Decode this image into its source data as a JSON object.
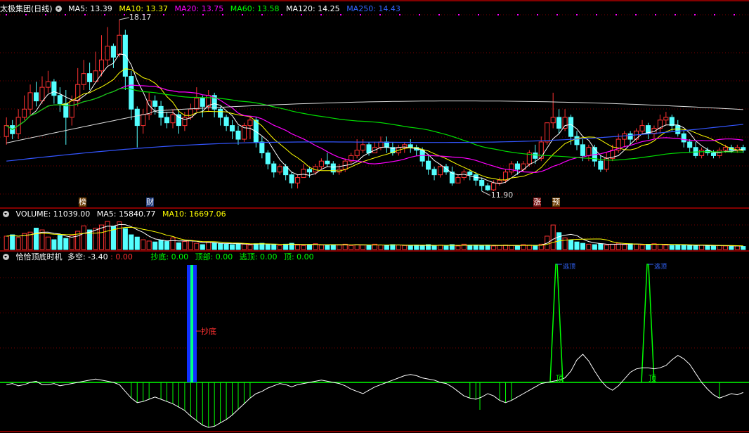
{
  "panel1": {
    "title": "太极集团(日线)",
    "indicators": [
      {
        "label": "MA5: 13.39",
        "color": "#ffffff"
      },
      {
        "label": "MA10: 13.37",
        "color": "#ffff00"
      },
      {
        "label": "MA20: 13.75",
        "color": "#ff00ff"
      },
      {
        "label": "MA60: 13.58",
        "color": "#00ff00"
      },
      {
        "label": "MA120: 14.25",
        "color": "#ffffff"
      },
      {
        "label": "MA250: 14.43",
        "color": "#3366ff"
      }
    ],
    "high_label": "18.17",
    "low_label": "11.90",
    "markers": [
      {
        "text": "榜",
        "color": "#ffb060"
      },
      {
        "text": "财",
        "color": "#88aaff"
      },
      {
        "text": "涨",
        "color": "#ff6060"
      },
      {
        "text": "预",
        "color": "#ffb060"
      }
    ]
  },
  "panel2": {
    "indicators": [
      {
        "label": "VOLUME: 11039.00",
        "color": "#ffffff"
      },
      {
        "label": "MA5: 15840.77",
        "color": "#ffffff"
      },
      {
        "label": "MA10: 16697.06",
        "color": "#ffff00"
      }
    ]
  },
  "panel3": {
    "indicators": [
      {
        "label": "恰恰顶底时机",
        "color": "#ffffff"
      },
      {
        "label": "多空: -3.40",
        "color": "#ffffff"
      },
      {
        "label": ": 0.00",
        "color": "#ff3030"
      },
      {
        "label": "抄底: 0.00",
        "color": "#00ff00"
      },
      {
        "label": "顶部: 0.00",
        "color": "#00ff00"
      },
      {
        "label": "逃顶: 0.00",
        "color": "#00ff00"
      },
      {
        "label": "顶: 0.00",
        "color": "#00ff00"
      }
    ],
    "buy_label": "抄底",
    "top_label": "顶",
    "escape_label": "逃顶"
  },
  "colors": {
    "up": "#ff3232",
    "down": "#54ffff",
    "grid": "#7a0000",
    "border": "#b00000"
  },
  "chart_data": [
    {
      "type": "candlestick",
      "title": "太极集团(日线)",
      "y_high": 18.17,
      "y_low": 11.9,
      "candles": [
        [
          13.9,
          14.3,
          14.6,
          13.6
        ],
        [
          14.3,
          14.0,
          14.5,
          13.8
        ],
        [
          14.0,
          14.6,
          14.9,
          13.8
        ],
        [
          14.6,
          14.9,
          15.4,
          14.5
        ],
        [
          14.9,
          15.5,
          15.8,
          14.7
        ],
        [
          15.5,
          15.2,
          15.9,
          15.0
        ],
        [
          15.2,
          15.7,
          16.1,
          15.1
        ],
        [
          15.7,
          15.9,
          16.3,
          15.5
        ],
        [
          15.9,
          15.4,
          16.0,
          15.1
        ],
        [
          15.4,
          15.1,
          15.7,
          14.8
        ],
        [
          15.1,
          14.6,
          15.6,
          13.6
        ],
        [
          14.6,
          15.2,
          15.4,
          14.3
        ],
        [
          15.2,
          15.8,
          16.4,
          15.0
        ],
        [
          15.8,
          16.2,
          16.7,
          15.6
        ],
        [
          16.2,
          15.9,
          16.6,
          15.6
        ],
        [
          15.9,
          16.3,
          17.0,
          15.9
        ],
        [
          16.3,
          16.7,
          17.6,
          16.1
        ],
        [
          16.7,
          17.2,
          17.9,
          16.5
        ],
        [
          17.2,
          16.8,
          17.3,
          16.4
        ],
        [
          16.9,
          17.6,
          18.17,
          16.8
        ],
        [
          17.6,
          16.1,
          17.8,
          15.6
        ],
        [
          16.1,
          14.9,
          16.3,
          14.5
        ],
        [
          14.9,
          14.3,
          15.0,
          13.5
        ],
        [
          14.3,
          14.7,
          14.9,
          14.0
        ],
        [
          14.7,
          15.2,
          15.5,
          14.5
        ],
        [
          15.2,
          15.0,
          15.4,
          14.7
        ],
        [
          15.0,
          14.6,
          15.2,
          14.3
        ],
        [
          14.6,
          14.4,
          14.8,
          14.2
        ],
        [
          14.4,
          14.7,
          14.9,
          14.2
        ],
        [
          14.7,
          14.3,
          14.9,
          14.0
        ],
        [
          14.3,
          14.6,
          14.8,
          14.1
        ],
        [
          14.6,
          14.9,
          15.1,
          14.5
        ],
        [
          14.9,
          15.3,
          15.7,
          14.8
        ],
        [
          15.3,
          15.0,
          15.4,
          14.6
        ],
        [
          15.0,
          15.4,
          15.6,
          14.8
        ],
        [
          15.4,
          14.9,
          15.5,
          14.6
        ],
        [
          14.9,
          14.6,
          15.0,
          14.3
        ],
        [
          14.6,
          14.3,
          14.7,
          14.1
        ],
        [
          14.3,
          14.1,
          14.5,
          13.8
        ],
        [
          14.1,
          13.8,
          14.3,
          13.6
        ],
        [
          13.8,
          14.3,
          14.4,
          13.7
        ],
        [
          14.3,
          14.5,
          14.6,
          13.8
        ],
        [
          14.5,
          13.7,
          14.6,
          13.5
        ],
        [
          13.7,
          13.3,
          13.9,
          13.1
        ],
        [
          13.3,
          12.9,
          13.4,
          12.7
        ],
        [
          12.9,
          12.6,
          13.0,
          12.4
        ],
        [
          12.6,
          12.8,
          12.9,
          12.5
        ],
        [
          12.8,
          12.5,
          12.9,
          12.3
        ],
        [
          12.5,
          12.2,
          12.6,
          12.0
        ],
        [
          12.2,
          12.4,
          12.5,
          12.0
        ],
        [
          12.4,
          12.7,
          12.9,
          12.4
        ],
        [
          12.7,
          12.6,
          12.8,
          12.4
        ],
        [
          12.6,
          12.8,
          12.9,
          12.5
        ],
        [
          12.8,
          13.0,
          13.1,
          12.7
        ],
        [
          13.0,
          12.9,
          13.3,
          12.8
        ],
        [
          12.9,
          12.6,
          13.0,
          12.5
        ],
        [
          12.6,
          12.7,
          12.9,
          12.5
        ],
        [
          12.7,
          13.0,
          13.1,
          12.6
        ],
        [
          13.0,
          13.2,
          13.3,
          12.9
        ],
        [
          13.2,
          13.4,
          13.8,
          13.1
        ],
        [
          13.4,
          13.6,
          13.8,
          13.3
        ],
        [
          13.6,
          13.3,
          13.7,
          13.2
        ],
        [
          13.3,
          13.5,
          13.7,
          13.3
        ],
        [
          13.5,
          13.7,
          13.9,
          13.4
        ],
        [
          13.7,
          13.5,
          13.9,
          13.3
        ],
        [
          13.5,
          13.3,
          13.7,
          13.2
        ],
        [
          13.3,
          13.5,
          13.6,
          13.2
        ],
        [
          13.5,
          13.6,
          13.7,
          13.3
        ],
        [
          13.6,
          13.5,
          13.8,
          13.3
        ],
        [
          13.5,
          13.4,
          13.6,
          13.2
        ],
        [
          13.4,
          13.0,
          13.5,
          12.8
        ],
        [
          13.0,
          12.7,
          13.2,
          12.5
        ],
        [
          12.7,
          12.5,
          12.8,
          12.3
        ],
        [
          12.5,
          12.8,
          12.9,
          12.4
        ],
        [
          12.8,
          12.6,
          12.9,
          12.5
        ],
        [
          12.6,
          12.2,
          12.8,
          12.1
        ],
        [
          12.2,
          12.4,
          12.5,
          12.2
        ],
        [
          12.4,
          12.6,
          12.7,
          12.3
        ],
        [
          12.6,
          12.5,
          12.7,
          12.3
        ],
        [
          12.5,
          12.3,
          12.6,
          12.1
        ],
        [
          12.3,
          12.1,
          12.4,
          11.9
        ],
        [
          12.1,
          11.95,
          12.2,
          11.9
        ],
        [
          11.95,
          12.2,
          12.3,
          11.9
        ],
        [
          12.2,
          12.3,
          12.4,
          12.1
        ],
        [
          12.3,
          12.6,
          12.7,
          12.2
        ],
        [
          12.6,
          12.9,
          13.0,
          12.5
        ],
        [
          12.9,
          12.7,
          13.0,
          12.5
        ],
        [
          12.7,
          12.9,
          13.0,
          12.6
        ],
        [
          12.9,
          13.3,
          13.4,
          12.8
        ],
        [
          13.3,
          13.1,
          13.6,
          12.9
        ],
        [
          13.1,
          13.7,
          13.9,
          13.0
        ],
        [
          13.7,
          14.4,
          14.4,
          13.6
        ],
        [
          14.4,
          14.6,
          15.5,
          14.2
        ],
        [
          14.6,
          14.2,
          14.9,
          14.0
        ],
        [
          14.2,
          14.6,
          14.9,
          14.1
        ],
        [
          14.6,
          13.9,
          14.7,
          13.6
        ],
        [
          13.9,
          13.6,
          14.1,
          13.4
        ],
        [
          13.6,
          13.2,
          13.8,
          13.0
        ],
        [
          13.2,
          13.5,
          13.6,
          13.0
        ],
        [
          13.5,
          13.0,
          13.6,
          12.8
        ],
        [
          13.0,
          12.7,
          13.2,
          12.6
        ],
        [
          12.7,
          13.1,
          13.3,
          12.6
        ],
        [
          13.1,
          13.4,
          13.6,
          13.0
        ],
        [
          13.4,
          13.8,
          14.0,
          13.3
        ],
        [
          13.8,
          14.0,
          14.1,
          13.5
        ],
        [
          14.0,
          13.8,
          14.1,
          13.6
        ],
        [
          13.8,
          14.1,
          14.2,
          13.7
        ],
        [
          14.1,
          14.3,
          14.5,
          14.0
        ],
        [
          14.3,
          14.0,
          14.4,
          13.8
        ],
        [
          14.0,
          14.2,
          14.3,
          13.8
        ],
        [
          14.2,
          14.5,
          14.7,
          14.0
        ],
        [
          14.5,
          14.6,
          14.8,
          14.3
        ],
        [
          14.6,
          14.3,
          14.7,
          14.1
        ],
        [
          14.3,
          14.0,
          14.5,
          13.9
        ],
        [
          14.0,
          13.7,
          14.1,
          13.5
        ],
        [
          13.7,
          13.5,
          13.8,
          13.3
        ],
        [
          13.5,
          13.2,
          13.7,
          13.1
        ],
        [
          13.2,
          13.4,
          13.5,
          13.1
        ],
        [
          13.4,
          13.3,
          13.5,
          13.2
        ],
        [
          13.3,
          13.2,
          13.4,
          13.1
        ],
        [
          13.2,
          13.4,
          13.5,
          13.1
        ],
        [
          13.4,
          13.5,
          13.6,
          13.3
        ],
        [
          13.5,
          13.4,
          13.6,
          13.3
        ],
        [
          13.4,
          13.5,
          13.6,
          13.3
        ],
        [
          13.5,
          13.4,
          13.6,
          13.3
        ]
      ]
    },
    {
      "type": "bar",
      "title": "VOLUME",
      "values": [
        30,
        33,
        27,
        36,
        39,
        48,
        44,
        28,
        22,
        32,
        25,
        31,
        41,
        53,
        44,
        48,
        55,
        63,
        52,
        62,
        47,
        33,
        28,
        22,
        19,
        17,
        21,
        18,
        26,
        15,
        18,
        20,
        14,
        11,
        17,
        15,
        13,
        12,
        11,
        14,
        12,
        10,
        13,
        14,
        12,
        11,
        9,
        12,
        14,
        10,
        9,
        11,
        13,
        10,
        9,
        11,
        10,
        12,
        9,
        11,
        10,
        9,
        12,
        10,
        9,
        11,
        10,
        9,
        8,
        10,
        9,
        11,
        8,
        10,
        9,
        11,
        8,
        12,
        9,
        10,
        9,
        10,
        8,
        9,
        10,
        9,
        8,
        11,
        10,
        9,
        12,
        30,
        55,
        38,
        26,
        21,
        17,
        14,
        12,
        11,
        13,
        10,
        12,
        14,
        11,
        13,
        12,
        10,
        11,
        13,
        12,
        10,
        9,
        11,
        10,
        9,
        8,
        10,
        9,
        8,
        9,
        8,
        7,
        8,
        7
      ]
    },
    {
      "type": "line",
      "title": "恰恰顶底时机",
      "values": [
        -2,
        -1,
        -3,
        -2,
        0,
        1,
        -2,
        -2,
        -1,
        -3,
        -2,
        -1,
        0,
        1,
        2,
        3,
        2,
        1,
        0,
        -2,
        -8,
        -14,
        -18,
        -17,
        -15,
        -13,
        -15,
        -17,
        -19,
        -22,
        -25,
        -30,
        -34,
        -38,
        -40,
        -39,
        -36,
        -33,
        -29,
        -24,
        -19,
        -14,
        -10,
        -8,
        -5,
        -3,
        -1,
        -2,
        -4,
        -2,
        -1,
        0,
        1,
        2,
        1,
        0,
        -1,
        -3,
        -6,
        -8,
        -10,
        -7,
        -4,
        -2,
        0,
        2,
        4,
        6,
        7,
        6,
        4,
        3,
        2,
        0,
        -1,
        -4,
        -8,
        -12,
        -14,
        -15,
        -13,
        -10,
        -12,
        -16,
        -18,
        -16,
        -13,
        -10,
        -7,
        -4,
        -1,
        0,
        1,
        2,
        4,
        10,
        20,
        25,
        19,
        10,
        2,
        -4,
        -7,
        -3,
        3,
        9,
        12,
        13,
        13,
        12,
        13,
        15,
        20,
        24,
        21,
        16,
        8,
        0,
        -6,
        -11,
        -14,
        -12,
        -10,
        -11,
        -9
      ]
    }
  ]
}
